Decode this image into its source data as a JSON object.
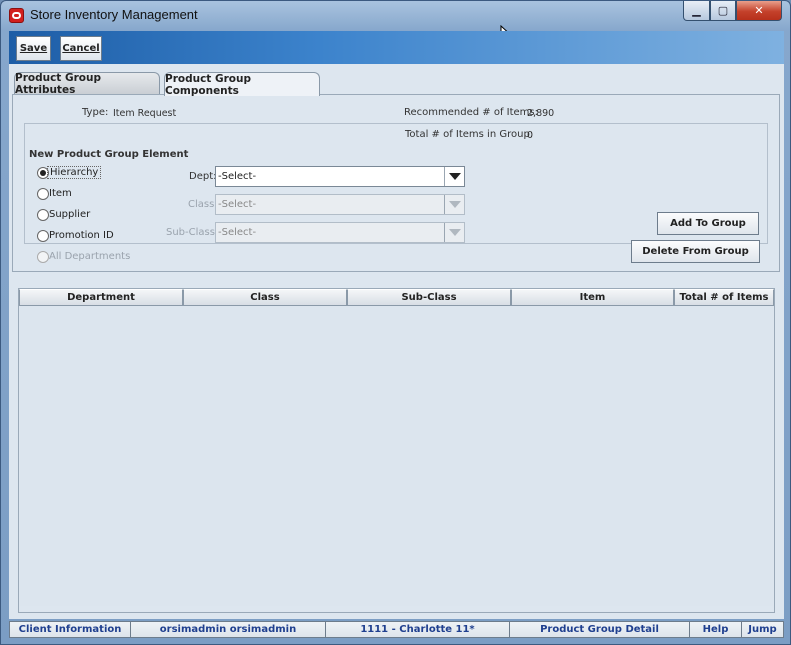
{
  "window": {
    "title": "Store Inventory Management",
    "controls": {
      "minimize": "▁",
      "maximize": "▢",
      "close": "✕"
    }
  },
  "toolbar": {
    "save_label": "Save",
    "cancel_label": "Cancel"
  },
  "tabs": [
    {
      "label": "Product Group Attributes",
      "active": false
    },
    {
      "label": "Product Group Components",
      "active": true
    }
  ],
  "summary": {
    "type_label": "Type:",
    "type_value": "Item Request",
    "recommended_label": "Recommended # of Items:",
    "recommended_value": "2,890",
    "total_label": "Total # of Items in Group:",
    "total_value": "0"
  },
  "group": {
    "title": "New Product Group Element",
    "radios": [
      {
        "label": "Hierarchy",
        "checked": true,
        "disabled": false
      },
      {
        "label": "Item",
        "checked": false,
        "disabled": false
      },
      {
        "label": "Supplier",
        "checked": false,
        "disabled": false
      },
      {
        "label": "Promotion ID",
        "checked": false,
        "disabled": false
      },
      {
        "label": "All Departments",
        "checked": false,
        "disabled": true
      }
    ],
    "dept": {
      "label": "Dept:",
      "value": "-Select-"
    },
    "class": {
      "label": "Class:",
      "value": "-Select-"
    },
    "subclass": {
      "label": "Sub-Class:",
      "value": "-Select-"
    },
    "add_label": "Add To Group",
    "delete_label": "Delete From Group"
  },
  "table": {
    "columns": [
      "Department",
      "Class",
      "Sub-Class",
      "Item",
      "Total # of Items"
    ],
    "rows": []
  },
  "statusbar": [
    "Client Information",
    "orsimadmin orsimadmin",
    "1111 - Charlotte 11*",
    "Product Group Detail",
    "Help",
    "Jump"
  ],
  "colors": {
    "accent": "#1d5da6",
    "status_text": "#1f3f8f",
    "panel_bg": "#dde6ef"
  }
}
